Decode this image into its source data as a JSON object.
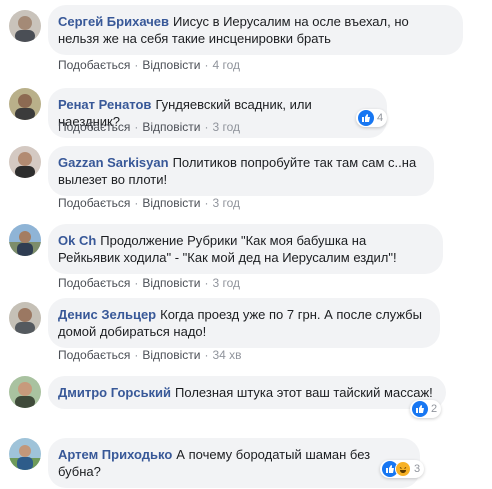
{
  "actions": {
    "like": "Подобається",
    "reply": "Відповісти",
    "sep": "·"
  },
  "comments": [
    {
      "author": "Сергей Брихачев",
      "text": "Иисус в Иерусалим на осле въехал, но нельзя же на себя такие инсценировки брать",
      "time": "4 год",
      "reactions": null
    },
    {
      "author": "Ренат Ренатов",
      "text": "Гундяевский всадник, или наездник?",
      "time": "3 год",
      "reactions": "4"
    },
    {
      "author": "Gazzan Sarkisyan",
      "text": "Политиков попробуйте так там сам с..на вылезет во плоти!",
      "time": "3 год",
      "reactions": null
    },
    {
      "author": "Ok Ch",
      "text": "Продолжение Рубрики \"Как моя бабушка на Рейкьявик ходила\" - \"Как мой дед на Иерусалим ездил\"!",
      "time": "3 год",
      "reactions": null
    },
    {
      "author": "Денис Зельцер",
      "text": "Когда проезд уже по 7 грн. А после службы домой добираться надо!",
      "time": "34 хв",
      "reactions": null
    },
    {
      "author": "Дмитро Горський",
      "text": "Полезная штука этот ваш тайский массаж!",
      "time": "",
      "reactions": "2"
    },
    {
      "author": "Артем Приходько",
      "text": "А почему бородатый шаман без бубна?",
      "time": "",
      "reactions": "3"
    }
  ],
  "colors": {
    "author": "#385898",
    "bubble": "#f2f3f5",
    "like": "#1877f2",
    "haha": "#f7b125"
  }
}
